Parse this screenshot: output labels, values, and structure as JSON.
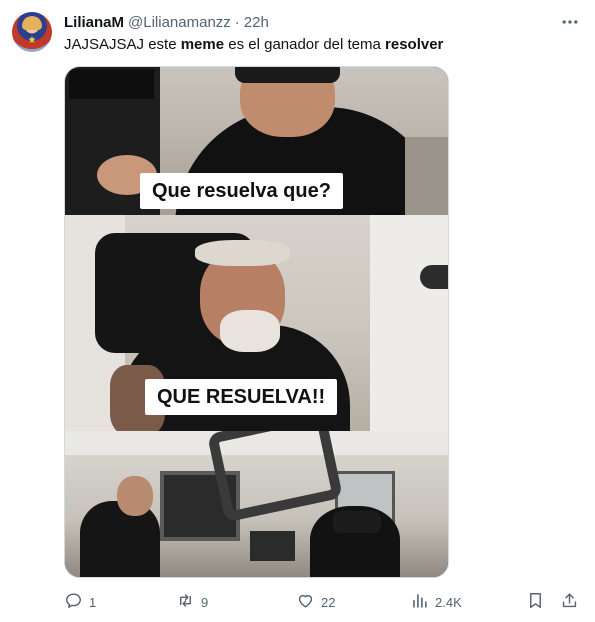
{
  "tweet": {
    "author": {
      "name": "LilianaM",
      "handle": "@Lilianamanzz",
      "dot": "·",
      "time": "22h"
    },
    "text": {
      "part1": "JAJSAJSAJ este ",
      "bold1": "meme",
      "part2": " es el ganador del tema ",
      "bold2": "resolver"
    },
    "media": {
      "caption_top": "Que resuelva que?",
      "caption_middle": "QUE RESUELVA!!"
    },
    "actions": {
      "replies": "1",
      "retweets": "9",
      "likes": "22",
      "views": "2.4K"
    },
    "icons": {
      "more": "more-dots-icon",
      "reply": "reply-bubble-icon",
      "retweet": "retweet-icon",
      "like": "heart-icon",
      "views": "views-bars-icon",
      "bookmark": "bookmark-icon",
      "share": "share-upload-icon"
    },
    "colors": {
      "text": "#0f1419",
      "muted": "#536471",
      "border": "#cfd9de"
    }
  }
}
